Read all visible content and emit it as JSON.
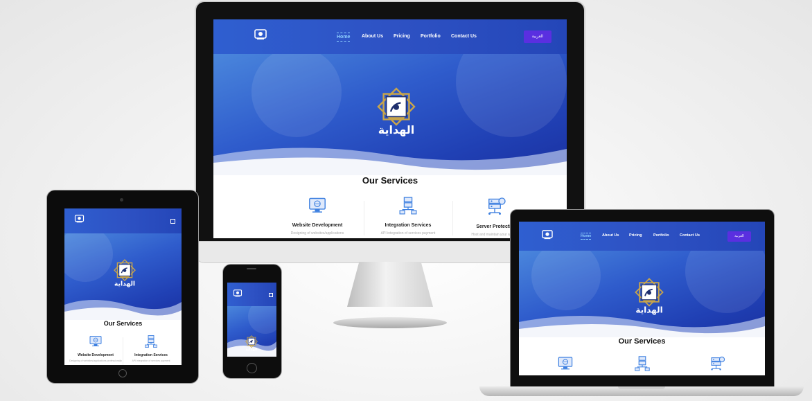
{
  "site": {
    "logo_text": "الهداية",
    "nav": [
      {
        "label": "Home",
        "active": true
      },
      {
        "label": "About Us",
        "active": false
      },
      {
        "label": "Pricing",
        "active": false
      },
      {
        "label": "Portfolio",
        "active": false
      },
      {
        "label": "Contact Us",
        "active": false
      }
    ],
    "language_button": "العربية",
    "services_title": "Our Services",
    "services": [
      {
        "name": "Website Development",
        "description": "Designing of websites/applications",
        "icon": "monitor-globe-icon"
      },
      {
        "name": "Integration Services",
        "description": "API integration of services payment",
        "icon": "network-servers-icon"
      },
      {
        "name": "Server Protection",
        "description": "Host and maintain your websites",
        "icon": "server-gear-icon"
      }
    ],
    "tablet_service_descriptions": [
      "Designing of websites/applications professionally",
      "API integration of services payment"
    ]
  },
  "colors": {
    "brand_blue": "#2e52c4",
    "accent_purple": "#5a2fe0",
    "active_link": "#8fd0ff",
    "logo_gold": "#c9a54a"
  }
}
